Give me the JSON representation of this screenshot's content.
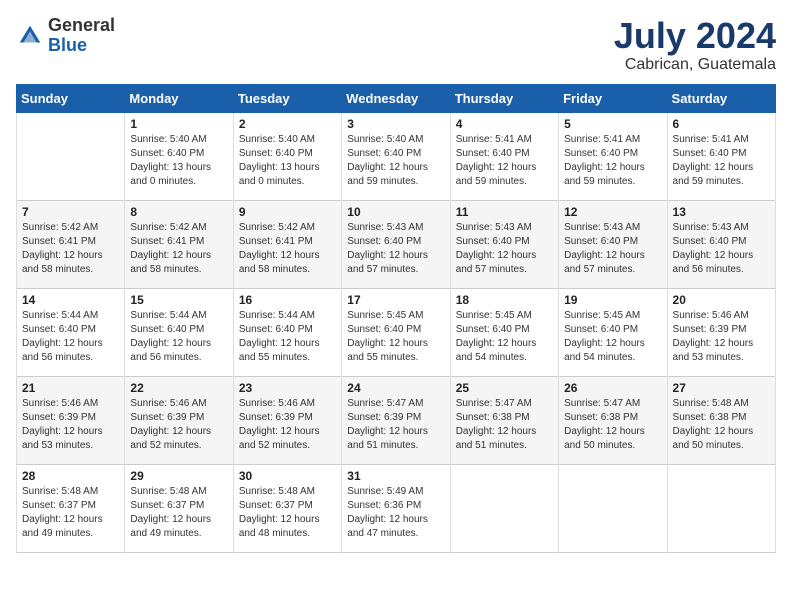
{
  "header": {
    "logo_general": "General",
    "logo_blue": "Blue",
    "month_year": "July 2024",
    "location": "Cabrican, Guatemala"
  },
  "weekdays": [
    "Sunday",
    "Monday",
    "Tuesday",
    "Wednesday",
    "Thursday",
    "Friday",
    "Saturday"
  ],
  "weeks": [
    [
      {
        "day": "",
        "sunrise": "",
        "sunset": "",
        "daylight": ""
      },
      {
        "day": "1",
        "sunrise": "Sunrise: 5:40 AM",
        "sunset": "Sunset: 6:40 PM",
        "daylight": "Daylight: 13 hours and 0 minutes."
      },
      {
        "day": "2",
        "sunrise": "Sunrise: 5:40 AM",
        "sunset": "Sunset: 6:40 PM",
        "daylight": "Daylight: 13 hours and 0 minutes."
      },
      {
        "day": "3",
        "sunrise": "Sunrise: 5:40 AM",
        "sunset": "Sunset: 6:40 PM",
        "daylight": "Daylight: 12 hours and 59 minutes."
      },
      {
        "day": "4",
        "sunrise": "Sunrise: 5:41 AM",
        "sunset": "Sunset: 6:40 PM",
        "daylight": "Daylight: 12 hours and 59 minutes."
      },
      {
        "day": "5",
        "sunrise": "Sunrise: 5:41 AM",
        "sunset": "Sunset: 6:40 PM",
        "daylight": "Daylight: 12 hours and 59 minutes."
      },
      {
        "day": "6",
        "sunrise": "Sunrise: 5:41 AM",
        "sunset": "Sunset: 6:40 PM",
        "daylight": "Daylight: 12 hours and 59 minutes."
      }
    ],
    [
      {
        "day": "7",
        "sunrise": "Sunrise: 5:42 AM",
        "sunset": "Sunset: 6:41 PM",
        "daylight": "Daylight: 12 hours and 58 minutes."
      },
      {
        "day": "8",
        "sunrise": "Sunrise: 5:42 AM",
        "sunset": "Sunset: 6:41 PM",
        "daylight": "Daylight: 12 hours and 58 minutes."
      },
      {
        "day": "9",
        "sunrise": "Sunrise: 5:42 AM",
        "sunset": "Sunset: 6:41 PM",
        "daylight": "Daylight: 12 hours and 58 minutes."
      },
      {
        "day": "10",
        "sunrise": "Sunrise: 5:43 AM",
        "sunset": "Sunset: 6:40 PM",
        "daylight": "Daylight: 12 hours and 57 minutes."
      },
      {
        "day": "11",
        "sunrise": "Sunrise: 5:43 AM",
        "sunset": "Sunset: 6:40 PM",
        "daylight": "Daylight: 12 hours and 57 minutes."
      },
      {
        "day": "12",
        "sunrise": "Sunrise: 5:43 AM",
        "sunset": "Sunset: 6:40 PM",
        "daylight": "Daylight: 12 hours and 57 minutes."
      },
      {
        "day": "13",
        "sunrise": "Sunrise: 5:43 AM",
        "sunset": "Sunset: 6:40 PM",
        "daylight": "Daylight: 12 hours and 56 minutes."
      }
    ],
    [
      {
        "day": "14",
        "sunrise": "Sunrise: 5:44 AM",
        "sunset": "Sunset: 6:40 PM",
        "daylight": "Daylight: 12 hours and 56 minutes."
      },
      {
        "day": "15",
        "sunrise": "Sunrise: 5:44 AM",
        "sunset": "Sunset: 6:40 PM",
        "daylight": "Daylight: 12 hours and 56 minutes."
      },
      {
        "day": "16",
        "sunrise": "Sunrise: 5:44 AM",
        "sunset": "Sunset: 6:40 PM",
        "daylight": "Daylight: 12 hours and 55 minutes."
      },
      {
        "day": "17",
        "sunrise": "Sunrise: 5:45 AM",
        "sunset": "Sunset: 6:40 PM",
        "daylight": "Daylight: 12 hours and 55 minutes."
      },
      {
        "day": "18",
        "sunrise": "Sunrise: 5:45 AM",
        "sunset": "Sunset: 6:40 PM",
        "daylight": "Daylight: 12 hours and 54 minutes."
      },
      {
        "day": "19",
        "sunrise": "Sunrise: 5:45 AM",
        "sunset": "Sunset: 6:40 PM",
        "daylight": "Daylight: 12 hours and 54 minutes."
      },
      {
        "day": "20",
        "sunrise": "Sunrise: 5:46 AM",
        "sunset": "Sunset: 6:39 PM",
        "daylight": "Daylight: 12 hours and 53 minutes."
      }
    ],
    [
      {
        "day": "21",
        "sunrise": "Sunrise: 5:46 AM",
        "sunset": "Sunset: 6:39 PM",
        "daylight": "Daylight: 12 hours and 53 minutes."
      },
      {
        "day": "22",
        "sunrise": "Sunrise: 5:46 AM",
        "sunset": "Sunset: 6:39 PM",
        "daylight": "Daylight: 12 hours and 52 minutes."
      },
      {
        "day": "23",
        "sunrise": "Sunrise: 5:46 AM",
        "sunset": "Sunset: 6:39 PM",
        "daylight": "Daylight: 12 hours and 52 minutes."
      },
      {
        "day": "24",
        "sunrise": "Sunrise: 5:47 AM",
        "sunset": "Sunset: 6:39 PM",
        "daylight": "Daylight: 12 hours and 51 minutes."
      },
      {
        "day": "25",
        "sunrise": "Sunrise: 5:47 AM",
        "sunset": "Sunset: 6:38 PM",
        "daylight": "Daylight: 12 hours and 51 minutes."
      },
      {
        "day": "26",
        "sunrise": "Sunrise: 5:47 AM",
        "sunset": "Sunset: 6:38 PM",
        "daylight": "Daylight: 12 hours and 50 minutes."
      },
      {
        "day": "27",
        "sunrise": "Sunrise: 5:48 AM",
        "sunset": "Sunset: 6:38 PM",
        "daylight": "Daylight: 12 hours and 50 minutes."
      }
    ],
    [
      {
        "day": "28",
        "sunrise": "Sunrise: 5:48 AM",
        "sunset": "Sunset: 6:37 PM",
        "daylight": "Daylight: 12 hours and 49 minutes."
      },
      {
        "day": "29",
        "sunrise": "Sunrise: 5:48 AM",
        "sunset": "Sunset: 6:37 PM",
        "daylight": "Daylight: 12 hours and 49 minutes."
      },
      {
        "day": "30",
        "sunrise": "Sunrise: 5:48 AM",
        "sunset": "Sunset: 6:37 PM",
        "daylight": "Daylight: 12 hours and 48 minutes."
      },
      {
        "day": "31",
        "sunrise": "Sunrise: 5:49 AM",
        "sunset": "Sunset: 6:36 PM",
        "daylight": "Daylight: 12 hours and 47 minutes."
      },
      {
        "day": "",
        "sunrise": "",
        "sunset": "",
        "daylight": ""
      },
      {
        "day": "",
        "sunrise": "",
        "sunset": "",
        "daylight": ""
      },
      {
        "day": "",
        "sunrise": "",
        "sunset": "",
        "daylight": ""
      }
    ]
  ]
}
